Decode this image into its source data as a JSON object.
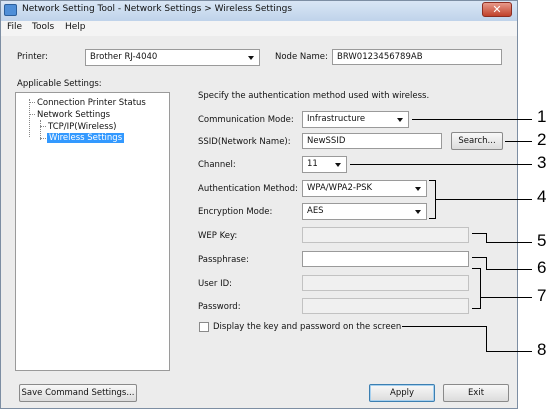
{
  "window": {
    "title": "Network Setting Tool - Network Settings > Wireless Settings",
    "close_glyph": "✕"
  },
  "menu": [
    {
      "label": "File"
    },
    {
      "label": "Tools"
    },
    {
      "label": "Help"
    }
  ],
  "printer": {
    "label": "Printer:",
    "value": "Brother RJ-4040"
  },
  "node_name": {
    "label": "Node Name:",
    "value": "BRW0123456789AB"
  },
  "applicable_settings": {
    "label": "Applicable Settings:",
    "tree": [
      {
        "label": "Connection Printer Status"
      },
      {
        "label": "Network Settings"
      },
      {
        "label": "TCP/IP(Wireless)"
      },
      {
        "label": "Wireless Settings",
        "selected": true
      }
    ]
  },
  "form": {
    "instruction": "Specify the authentication method used with wireless.",
    "communication_mode": {
      "label": "Communication Mode:",
      "value": "Infrastructure"
    },
    "ssid": {
      "label": "SSID(Network Name):",
      "value": "NewSSID",
      "search_label": "Search..."
    },
    "channel": {
      "label": "Channel:",
      "value": "11"
    },
    "auth_method": {
      "label": "Authentication Method:",
      "value": "WPA/WPA2-PSK"
    },
    "encryption": {
      "label": "Encryption Mode:",
      "value": "AES"
    },
    "wep_key": {
      "label": "WEP Key:",
      "value": ""
    },
    "passphrase": {
      "label": "Passphrase:",
      "value": ""
    },
    "user_id": {
      "label": "User ID:",
      "value": ""
    },
    "password": {
      "label": "Password:",
      "value": ""
    },
    "display_key": {
      "label": "Display the key and password on the screen",
      "checked": false
    }
  },
  "buttons": {
    "save_command": "Save Command Settings...",
    "apply": "Apply",
    "exit": "Exit"
  },
  "callouts": [
    "1",
    "2",
    "3",
    "4",
    "5",
    "6",
    "7",
    "8"
  ]
}
